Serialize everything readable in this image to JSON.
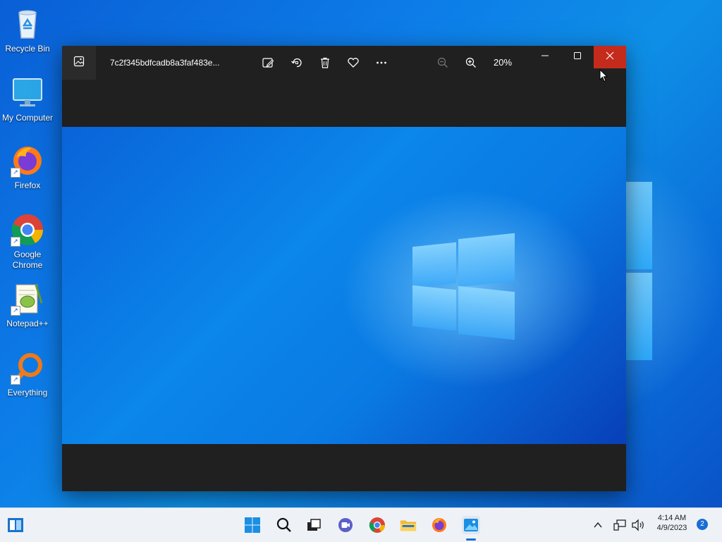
{
  "desktop": {
    "icons": [
      {
        "label": "Recycle Bin",
        "icon": "recycle-bin-icon"
      },
      {
        "label": "My Computer",
        "icon": "monitor-icon"
      },
      {
        "label": "Firefox",
        "icon": "firefox-icon"
      },
      {
        "label": "Google Chrome",
        "icon": "chrome-icon"
      },
      {
        "label": "Notepad++",
        "icon": "notepadpp-icon"
      },
      {
        "label": "Everything",
        "icon": "everything-icon"
      }
    ]
  },
  "photos_window": {
    "file_name": "7c2f345bdfcadb8a3faf483e...",
    "zoom_level": "20%",
    "toolbar": [
      "edit-image-icon",
      "rotate-icon",
      "delete-icon",
      "favorite-icon",
      "more-icon",
      "zoom-out-icon",
      "zoom-in-icon"
    ],
    "window_controls": [
      "minimize-icon",
      "maximize-icon",
      "close-icon"
    ],
    "colors": {
      "background": "#202020",
      "close_hover": "#c42b1c"
    }
  },
  "taskbar": {
    "pinned": [
      "start-icon",
      "search-icon",
      "task-view-icon",
      "chat-icon",
      "chrome-icon",
      "file-explorer-icon",
      "firefox-icon",
      "photos-icon"
    ],
    "tray": {
      "time": "4:14 AM",
      "date": "4/9/2023",
      "notification_count": "2"
    }
  }
}
